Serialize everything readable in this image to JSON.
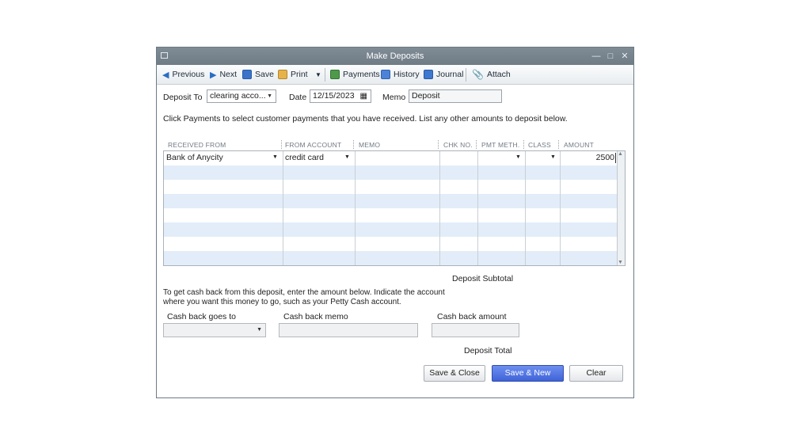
{
  "window": {
    "title": "Make Deposits"
  },
  "toolbar": {
    "previous": "Previous",
    "next": "Next",
    "save": "Save",
    "print": "Print",
    "payments": "Payments",
    "history": "History",
    "journal": "Journal",
    "attach": "Attach"
  },
  "form": {
    "deposit_to_label": "Deposit To",
    "deposit_to_value": "clearing acco...",
    "date_label": "Date",
    "date_value": "12/15/2023",
    "memo_label": "Memo",
    "memo_value": "Deposit",
    "instructions": "Click Payments to select customer payments that you have received. List any other amounts to deposit below."
  },
  "table": {
    "columns": [
      "RECEIVED FROM",
      "FROM ACCOUNT",
      "MEMO",
      "CHK NO.",
      "PMT METH.",
      "CLASS",
      "AMOUNT"
    ],
    "rows": [
      {
        "received_from": "Bank of Anycity",
        "from_account": "credit card",
        "memo": "",
        "chk_no": "",
        "pmt_meth": "",
        "class": "",
        "amount": "2500"
      }
    ]
  },
  "totals": {
    "subtotal_label": "Deposit Subtotal",
    "total_label": "Deposit Total"
  },
  "cashback": {
    "instructions_line1": "To get cash back from this deposit, enter the amount below.  Indicate the account",
    "instructions_line2": "where you want this money to go, such as your Petty Cash account.",
    "goes_to_label": "Cash back goes to",
    "memo_label": "Cash back memo",
    "amount_label": "Cash back amount"
  },
  "buttons": {
    "save_close": "Save & Close",
    "save_new": "Save & New",
    "clear": "Clear"
  },
  "colors": {
    "titlebar": "#737f89",
    "row_stripe": "#e2edf9",
    "primary_button": "#4a6fe0"
  }
}
